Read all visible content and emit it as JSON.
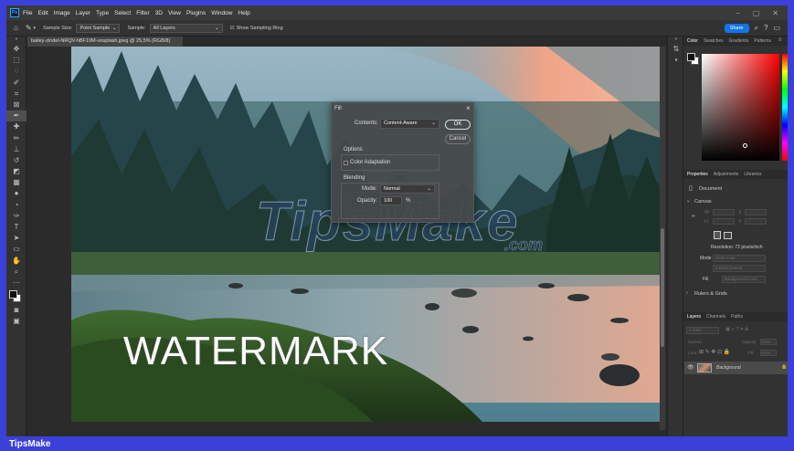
{
  "menubar": {
    "logo": "Ps",
    "items": [
      "File",
      "Edit",
      "Image",
      "Layer",
      "Type",
      "Select",
      "Filter",
      "3D",
      "View",
      "Plugins",
      "Window",
      "Help"
    ]
  },
  "options": {
    "sample_size_label": "Sample Size:",
    "sample_size_value": "Point Sample",
    "sample_label": "Sample:",
    "sample_value": "All Layers",
    "show_ring_label": "Show Sampling Ring",
    "share_label": "Share"
  },
  "document": {
    "tab_title": "bailey-zindel-NRQV-hBF10M-unsplash.jpeg @ 25,5% (RGB/8)"
  },
  "canvas": {
    "watermark_text": "WATERMARK",
    "tipsmake_mark": "TipsMake",
    "tipsmake_dotcom": ".com"
  },
  "fill_dialog": {
    "title": "Fill",
    "contents_label": "Contents:",
    "contents_value": "Content-Aware",
    "ok_label": "OK",
    "cancel_label": "Cancel",
    "options_label": "Options",
    "color_adaptation_label": "Color Adaptation",
    "blending_label": "Blending",
    "mode_label": "Mode:",
    "mode_value": "Normal",
    "opacity_label": "Opacity:",
    "opacity_value": "100",
    "opacity_unit": "%"
  },
  "color_panel": {
    "tabs": [
      "Color",
      "Swatches",
      "Gradients",
      "Patterns"
    ]
  },
  "properties_panel": {
    "tabs": [
      "Properties",
      "Adjustments",
      "Libraries"
    ],
    "doc_label": "Document",
    "canvas_label": "Canvas",
    "resolution_text": "Resolution: 72 pixels/inch",
    "mode_label": "Mode",
    "mode_value": "RGB Color",
    "bits_value": "8 Bits/Channel",
    "fill_label": "Fill",
    "fill_value": "Background Color",
    "rulers_label": "Rulers & Grids"
  },
  "layers_panel": {
    "tabs": [
      "Layers",
      "Channels",
      "Paths"
    ],
    "kind_placeholder": "Kind",
    "blend_value": "Normal",
    "opacity_label": "Opacity:",
    "opacity_value": "100%",
    "lock_label": "Lock:",
    "fill_label": "Fill:",
    "fill_value": "100%",
    "layer_name": "Background"
  },
  "footer": {
    "brand": "TipsMake"
  }
}
